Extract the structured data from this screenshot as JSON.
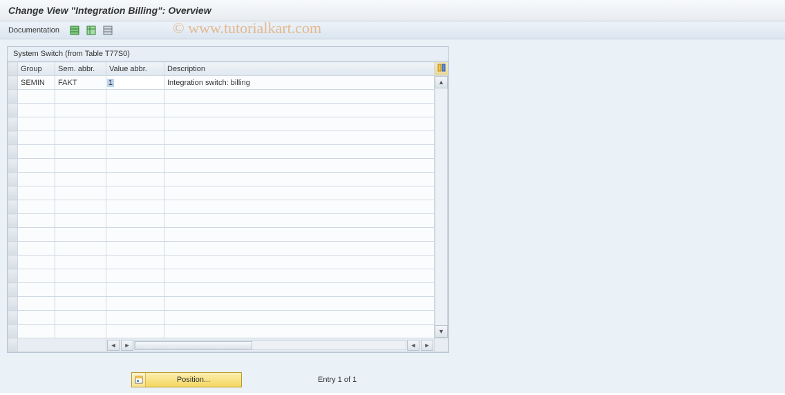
{
  "title": "Change View \"Integration Billing\": Overview",
  "toolbar": {
    "documentation_label": "Documentation"
  },
  "panel": {
    "title": "System Switch (from Table T77S0)",
    "columns": {
      "group": "Group",
      "sem": "Sem. abbr.",
      "val": "Value abbr.",
      "desc": "Description"
    },
    "row1": {
      "group": "SEMIN",
      "sem": "FAKT",
      "val": "1",
      "desc": "Integration switch: billing"
    }
  },
  "footer": {
    "position_label": "Position...",
    "entry_label": "Entry 1 of 1"
  },
  "watermark": "© www.tutorialkart.com"
}
